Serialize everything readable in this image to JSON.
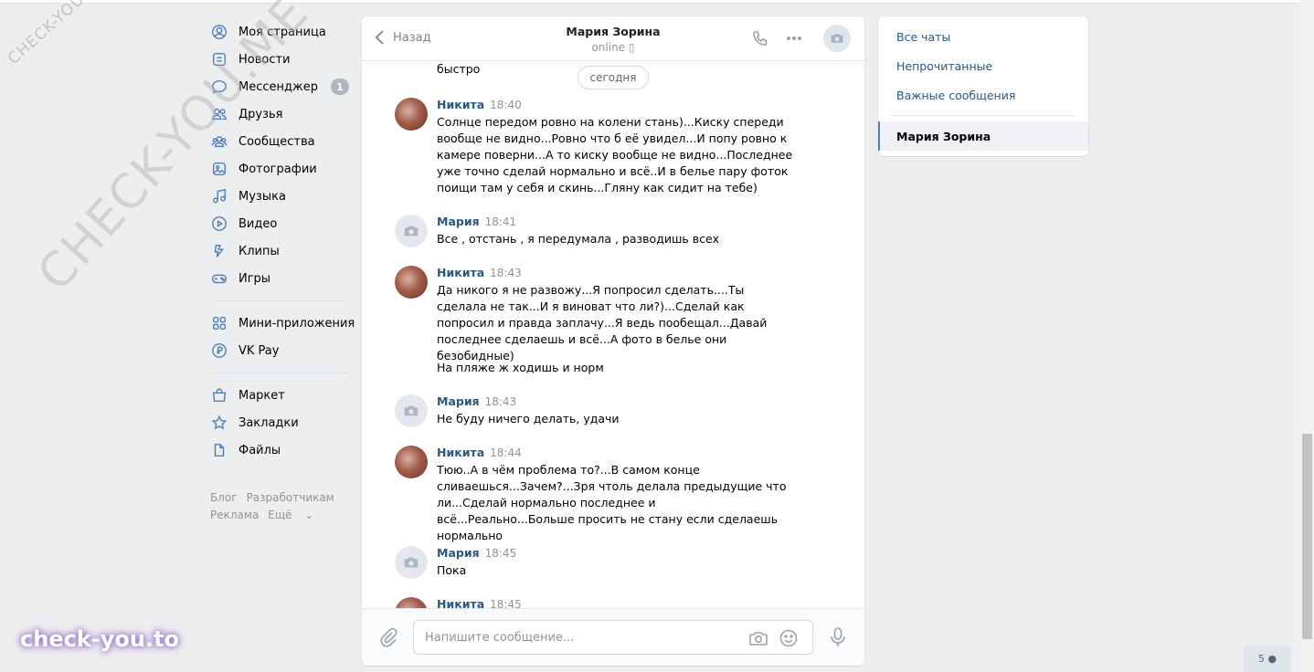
{
  "nav": {
    "items": [
      {
        "label": "Моя страница",
        "icon": "user-circle-icon"
      },
      {
        "label": "Новости",
        "icon": "news-icon"
      },
      {
        "label": "Мессенджер",
        "icon": "message-icon",
        "badge": "1"
      },
      {
        "label": "Друзья",
        "icon": "friends-icon"
      },
      {
        "label": "Сообщества",
        "icon": "communities-icon"
      },
      {
        "label": "Фотографии",
        "icon": "photo-icon"
      },
      {
        "label": "Музыка",
        "icon": "music-icon"
      },
      {
        "label": "Видео",
        "icon": "video-icon"
      },
      {
        "label": "Клипы",
        "icon": "clips-icon"
      },
      {
        "label": "Игры",
        "icon": "games-icon"
      },
      {
        "label": "Мини-приложения",
        "icon": "apps-icon"
      },
      {
        "label": "VK Pay",
        "icon": "pay-icon"
      },
      {
        "label": "Маркет",
        "icon": "market-icon"
      },
      {
        "label": "Закладки",
        "icon": "star-icon"
      },
      {
        "label": "Файлы",
        "icon": "file-icon"
      }
    ],
    "footer": {
      "blog": "Блог",
      "dev": "Разработчикам",
      "ads": "Реклама",
      "more": "Ещё"
    }
  },
  "chat": {
    "back_label": "Назад",
    "title": "Мария Зорина",
    "status": "online",
    "date_pill": "сегодня",
    "prev_text": "быстро",
    "messages": [
      {
        "author": "Никита",
        "time": "18:40",
        "avatar": "nikita",
        "text": "Солнце передом ровно на колени стань)...Киску спереди вообще не видно...Ровно что б её увидел...И попу ровно к камере поверни...А то киску вообще не видно...Последнее уже точно сделай нормально и всё..И в белье пару фоток поищи там у себя и скинь...Гляну как сидит на тебе)"
      },
      {
        "author": "Мария",
        "time": "18:41",
        "avatar": "maria",
        "text": "Все , отстань , я передумала , разводишь всех"
      },
      {
        "author": "Никита",
        "time": "18:43",
        "avatar": "nikita",
        "text": "Да никого я не развожу...Я попросил сделать....Ты сделала не так...И я виноват что ли?)...Сделай как попросил и правда заплачу...Я ведь пообещал...Давай последнее сделаешь и всё...А фото в белье они безобидные)",
        "extra": "На пляже ж ходишь и норм"
      },
      {
        "author": "Мария",
        "time": "18:43",
        "avatar": "maria",
        "text": "Не буду ничего делать, удачи"
      },
      {
        "author": "Никита",
        "time": "18:44",
        "avatar": "nikita",
        "text": "Тюю..А в чём проблема то?...В самом конце сливаешься...Зачем?...Зря чтоль делала предыдущие что ли...Сделай нормально последнее и всё...Реально...Больше просить не стану если сделаешь нормально"
      },
      {
        "author": "Мария",
        "time": "18:45",
        "avatar": "maria",
        "text": "Пока"
      },
      {
        "author": "Никита",
        "time": "18:45",
        "avatar": "nikita",
        "text": ""
      }
    ],
    "composer": {
      "placeholder": "Напишите сообщение..."
    }
  },
  "right": {
    "items": [
      "Все чаты",
      "Непрочитанные",
      "Важные сообщения"
    ],
    "active": "Мария Зорина"
  },
  "watermarks": {
    "small": "CHECK-YOU.ME",
    "big": "CHECK-YOU.ME",
    "logo": "check-you.to"
  },
  "online_count": "5"
}
